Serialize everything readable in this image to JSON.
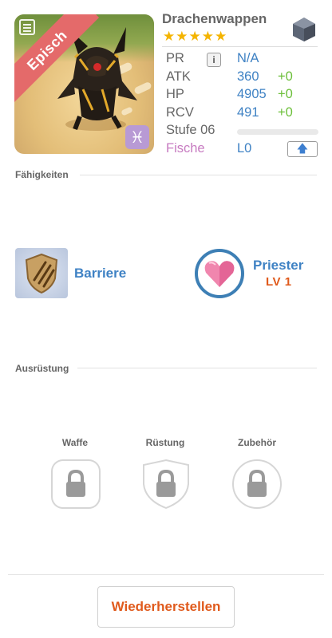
{
  "monster": {
    "name": "Drachenwappen",
    "rarity": "Episch",
    "stars": "★★★★★",
    "star_count": 5,
    "element_symbol": "♓",
    "stats": {
      "pr": {
        "label": "PR",
        "value": "N/A",
        "info_icon": "i"
      },
      "atk": {
        "label": "ATK",
        "value": "360",
        "bonus": "+0"
      },
      "hp": {
        "label": "HP",
        "value": "4905",
        "bonus": "+0"
      },
      "rcv": {
        "label": "RCV",
        "value": "491",
        "bonus": "+0"
      },
      "level": {
        "label": "Stufe 06",
        "progress": 0
      },
      "fish": {
        "label": "Fische",
        "value": "L0",
        "upgrade_icon": "🡅"
      }
    }
  },
  "abilities": {
    "title": "Fähigkeiten",
    "skill": {
      "name": "Barriere",
      "icon": "shield-claw-icon"
    },
    "class": {
      "name": "Priester",
      "level": "LV 1",
      "icon": "heart-icon"
    }
  },
  "equipment": {
    "title": "Ausrüstung",
    "slots": [
      {
        "label": "Waffe",
        "icon": "lock-icon"
      },
      {
        "label": "Rüstung",
        "icon": "lock-icon"
      },
      {
        "label": "Zubehör",
        "icon": "lock-icon"
      }
    ]
  },
  "actions": {
    "restore_label": "Wiederherstellen"
  },
  "colors": {
    "accent_blue": "#3f82c4",
    "bonus_green": "#6cbf3a",
    "orange": "#e05a1c",
    "rarity_red": "#e46a6a",
    "star_gold": "#f4b400"
  }
}
